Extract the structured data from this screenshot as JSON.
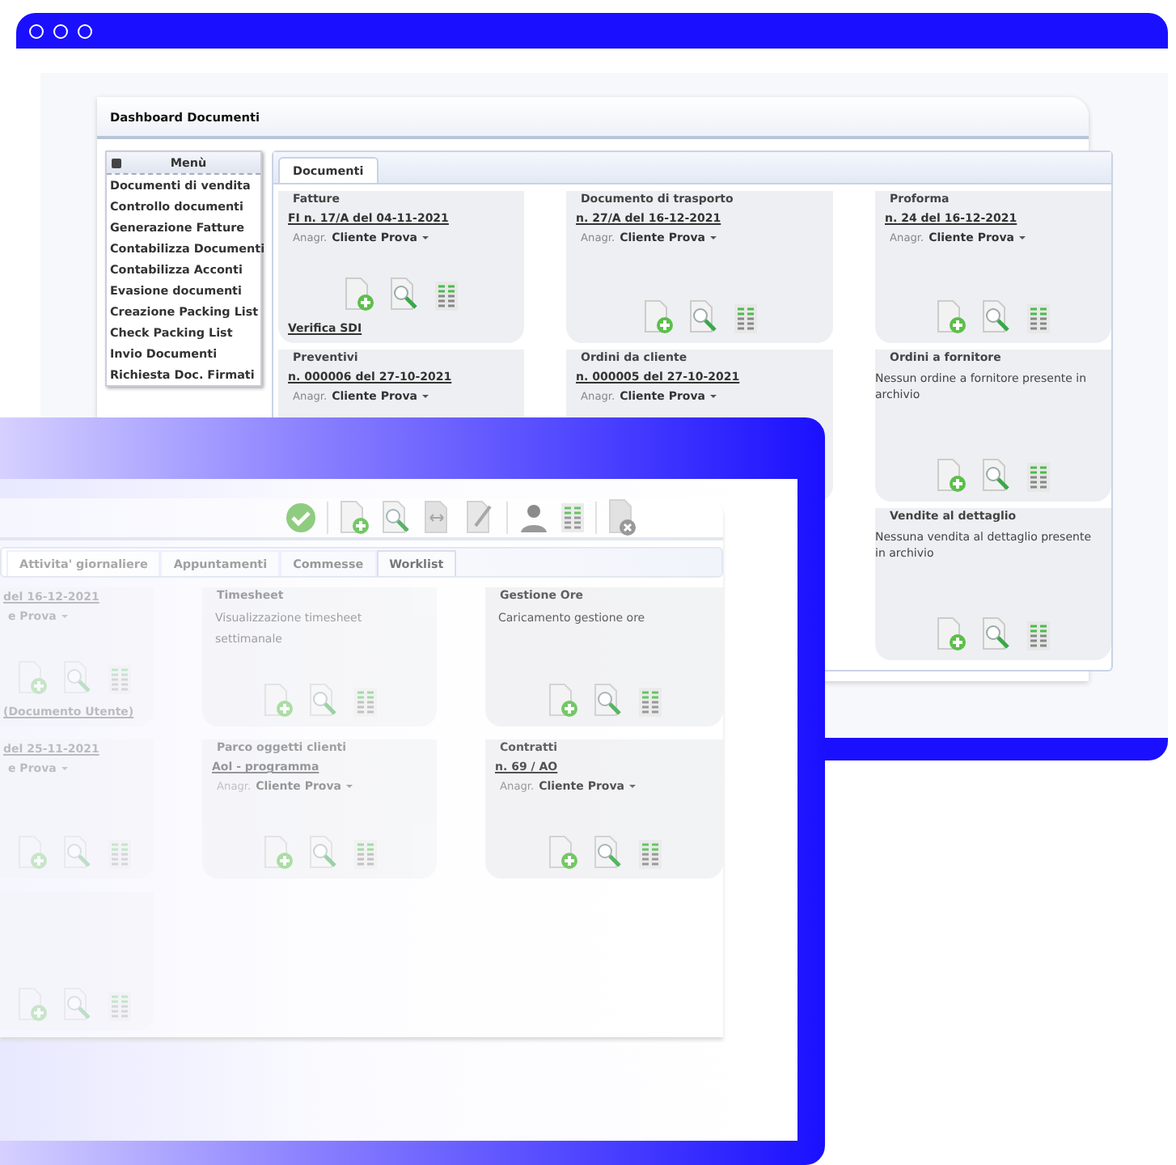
{
  "back_window": {
    "title": "Dashboard Documenti",
    "menu": {
      "title": "Menù",
      "items": [
        "Documenti di vendita",
        "Controllo documenti",
        "Generazione Fatture",
        "Contabilizza Documenti",
        "Contabilizza Acconti",
        "Evasione documenti",
        "Creazione Packing List",
        "Check Packing List",
        "Invio Documenti",
        "Richiesta Doc. Firmati"
      ]
    },
    "tabs": [
      {
        "label": "Documenti",
        "selected": true
      }
    ],
    "columns": [
      [
        {
          "title": "Fatture",
          "link": "FI n. 17/A del 04-11-2021",
          "client_label": "Anagr.",
          "client": "Cliente Prova",
          "actions": true,
          "extra_link": "Verifica SDI"
        },
        {
          "title": "Preventivi",
          "link": "n. 000006 del 27-10-2021",
          "client_label": "Anagr.",
          "client": "Cliente Prova"
        }
      ],
      [
        {
          "title": "Documento di trasporto",
          "link": "n. 27/A del 16-12-2021",
          "client_label": "Anagr.",
          "client": "Cliente Prova",
          "actions": true
        },
        {
          "title": "Ordini da cliente",
          "link": "n. 000005 del 27-10-2021",
          "client_label": "Anagr.",
          "client": "Cliente Prova"
        }
      ],
      [
        {
          "title": "Proforma",
          "link": "n. 24 del 16-12-2021",
          "client_label": "Anagr.",
          "client": "Cliente Prova",
          "actions": true
        },
        {
          "title": "Ordini a fornitore",
          "message": "Nessun ordine a fornitore presente in archivio",
          "actions": true
        },
        {
          "title": "Vendite al dettaglio",
          "message": "Nessuna vendita al dettaglio presente in archivio",
          "actions": true
        }
      ]
    ]
  },
  "front_window": {
    "tabs": [
      {
        "label": "Attivita' giornaliere",
        "selected": false
      },
      {
        "label": "Appuntamenti",
        "selected": false
      },
      {
        "label": "Commesse",
        "selected": false
      },
      {
        "label": "Worklist",
        "selected": true
      }
    ],
    "columns": [
      [
        {
          "link": "del 16-12-2021",
          "client": "e Prova",
          "actions": true,
          "extra_link": "(Documento Utente)"
        },
        {
          "link": "del 25-11-2021",
          "client": "e Prova",
          "actions": true
        },
        {
          "actions": true
        }
      ],
      [
        {
          "title": "Timesheet",
          "message": "Visualizzazione timesheet settimanale",
          "actions": true
        },
        {
          "title": "Parco oggetti clienti",
          "link": "Aol - programma",
          "client_label": "Anagr.",
          "client": "Cliente Prova",
          "actions": true
        }
      ],
      [
        {
          "title": "Gestione Ore",
          "message": "Caricamento gestione ore",
          "actions": true
        },
        {
          "title": "Contratti",
          "link": "n. 69 / AO",
          "client_label": "Anagr.",
          "client": "Cliente Prova",
          "actions": true
        }
      ]
    ]
  }
}
